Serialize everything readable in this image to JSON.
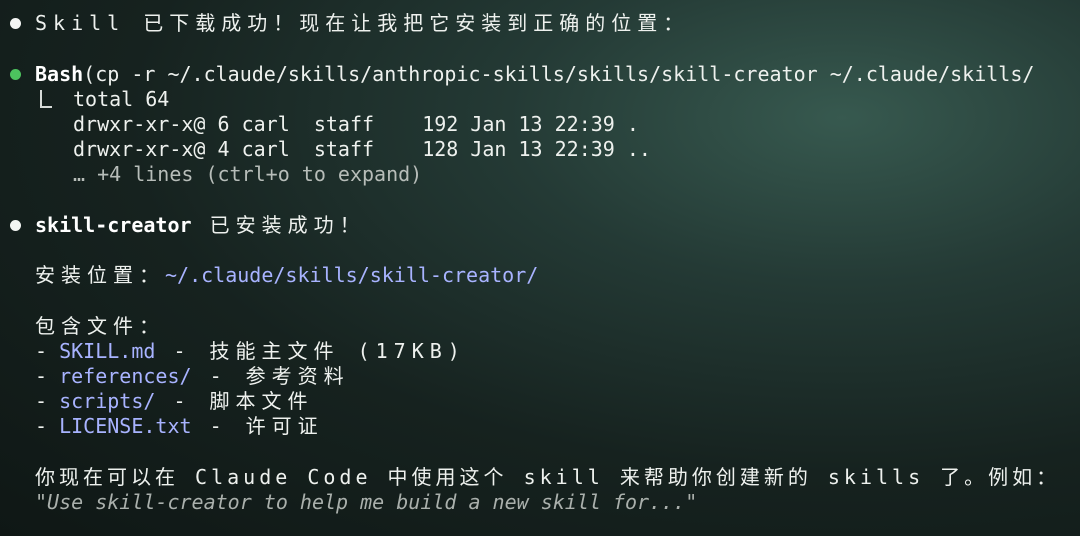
{
  "message1": "Skill 已下载成功！现在让我把它安装到正确的位置：",
  "bash": {
    "tool": "Bash",
    "command": "(cp -r ~/.claude/skills/anthropic-skills/skills/skill-creator ~/.claude/skills/",
    "output": [
      "total 64",
      "drwxr-xr-x@ 6 carl  staff    192 Jan 13 22:39 .",
      "drwxr-xr-x@ 4 carl  staff    128 Jan 13 22:39 .."
    ],
    "expand_hint": "… +4 lines (ctrl+o to expand)"
  },
  "message2": {
    "name": "skill-creator",
    "suffix": " 已安装成功！"
  },
  "install_location": {
    "label": "安装位置：",
    "path": "~/.claude/skills/skill-creator/"
  },
  "files": {
    "heading": "包含文件：",
    "items": [
      {
        "name": "SKILL.md",
        "desc": " - 技能主文件 (17KB)"
      },
      {
        "name": "references/",
        "desc": " - 参考资料"
      },
      {
        "name": "scripts/",
        "desc": " - 脚本文件"
      },
      {
        "name": "LICENSE.txt",
        "desc": " - 许可证"
      }
    ]
  },
  "usage": {
    "text": "你现在可以在 Claude Code 中使用这个 skill 来帮助你创建新的 skills 了。例如：",
    "example": "\"Use skill-creator to help me build a new skill for...\""
  },
  "colors": {
    "bullet_done": "#4cc35e",
    "path_accent": "#a8b3ff"
  }
}
